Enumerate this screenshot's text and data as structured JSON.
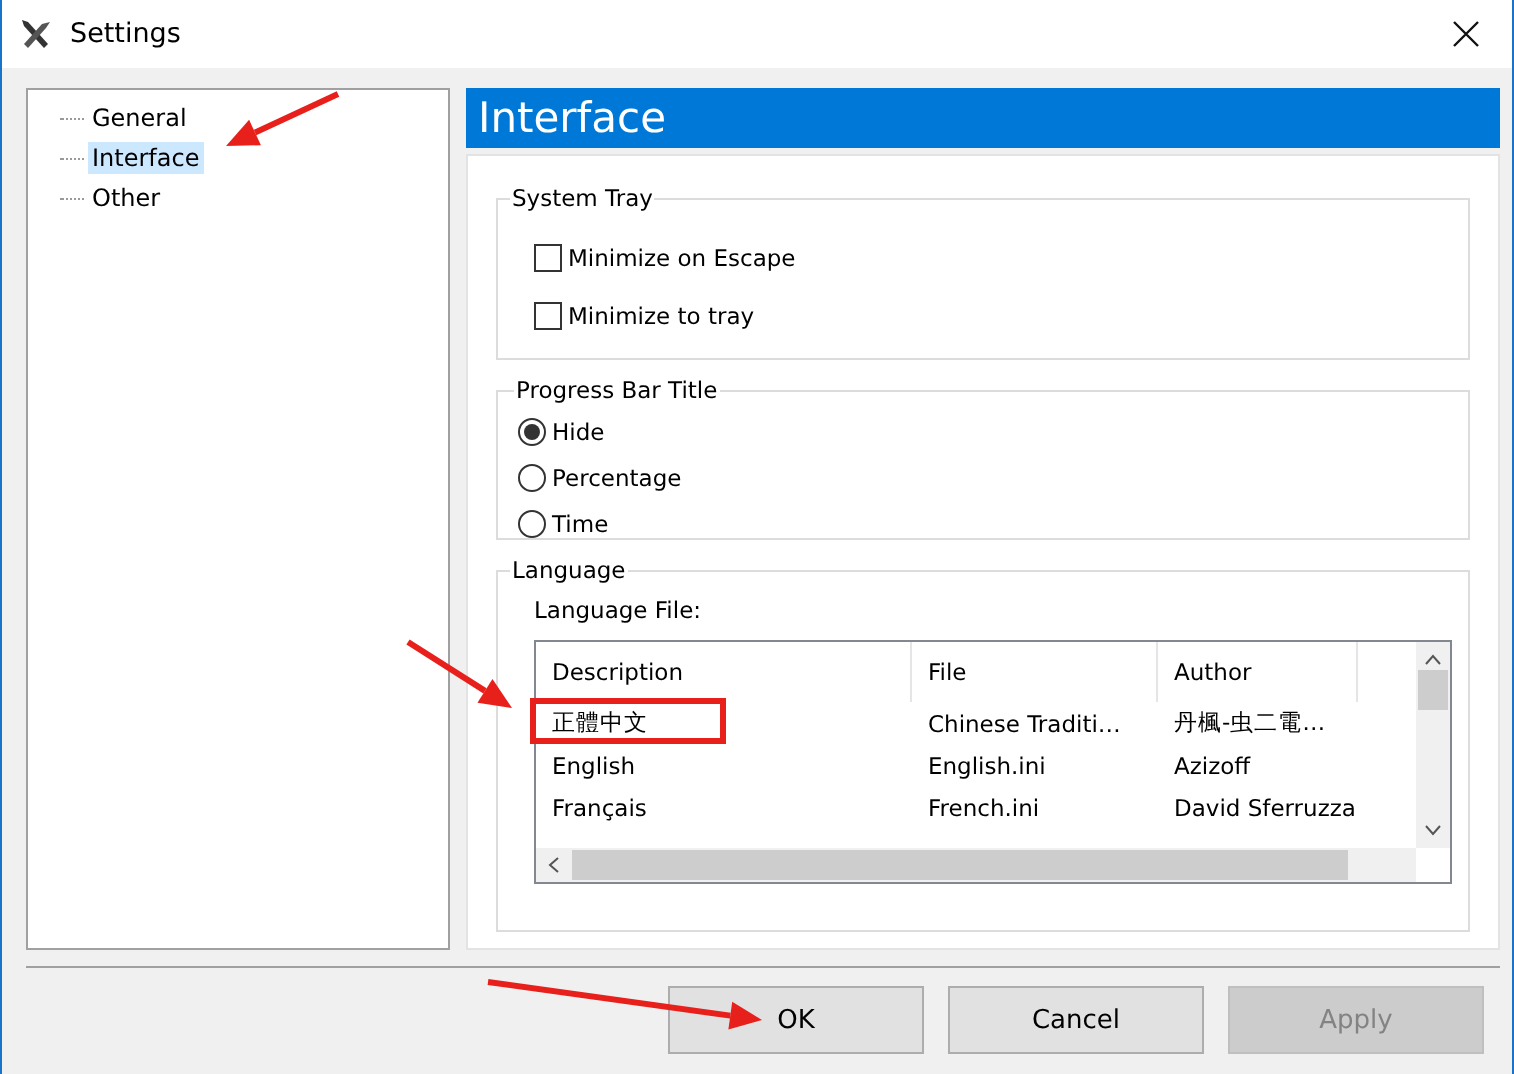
{
  "window": {
    "title": "Settings"
  },
  "tree": [
    {
      "label": "General",
      "selected": false
    },
    {
      "label": "Interface",
      "selected": true
    },
    {
      "label": "Other",
      "selected": false
    }
  ],
  "page_title": "Interface",
  "system_tray": {
    "title": "System Tray",
    "options": [
      {
        "label": "Minimize on Escape",
        "checked": false
      },
      {
        "label": "Minimize to tray",
        "checked": false
      }
    ]
  },
  "progress_bar_title": {
    "title": "Progress Bar Title",
    "options": [
      {
        "label": "Hide",
        "selected": true
      },
      {
        "label": "Percentage",
        "selected": false
      },
      {
        "label": "Time",
        "selected": false
      }
    ]
  },
  "language": {
    "title": "Language",
    "file_label": "Language File:",
    "columns": [
      "Description",
      "File",
      "Author"
    ],
    "rows": [
      [
        "正體中文",
        "Chinese Traditi…",
        "丹楓-虫二電…"
      ],
      [
        "English",
        "English.ini",
        "Azizoff"
      ],
      [
        "Français",
        "French.ini",
        "David Sferruzza"
      ]
    ]
  },
  "buttons": [
    {
      "label": "OK",
      "disabled": false
    },
    {
      "label": "Cancel",
      "disabled": false
    },
    {
      "label": "Apply",
      "disabled": true
    }
  ]
}
